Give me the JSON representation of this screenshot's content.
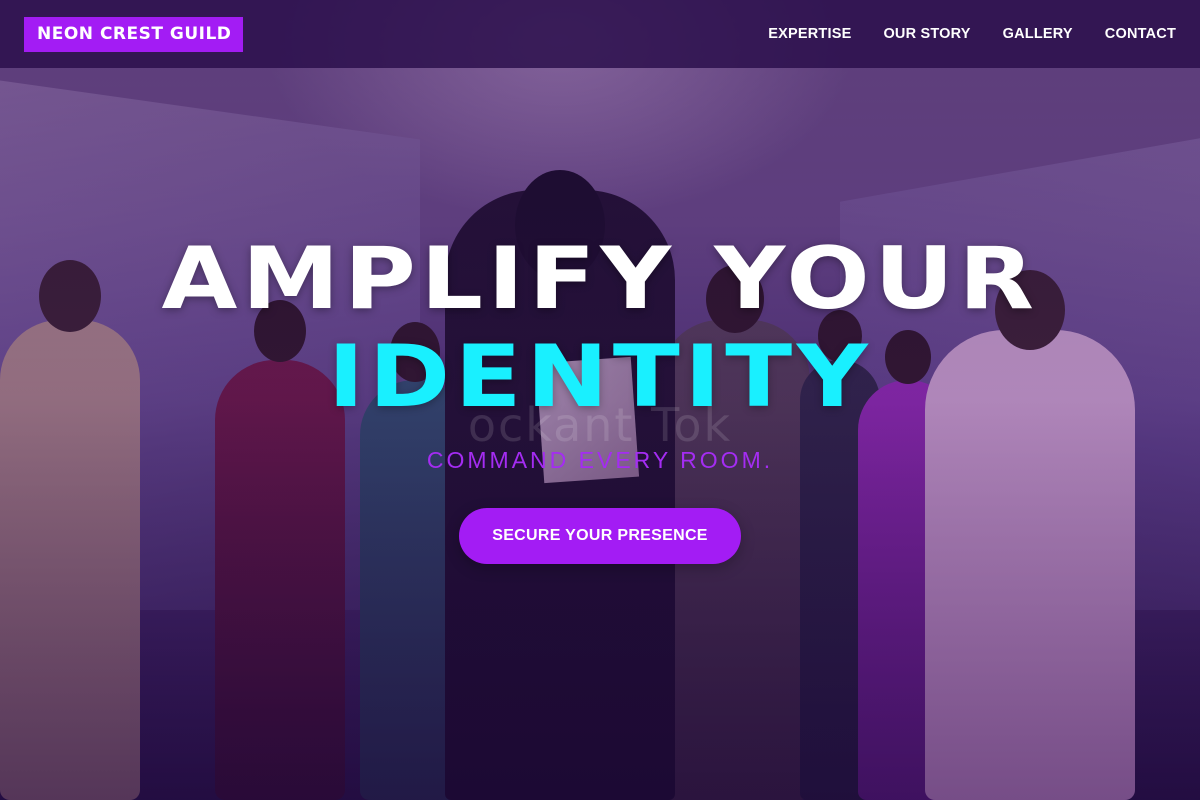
{
  "header": {
    "logo": "NEON CREST GUILD",
    "nav": [
      {
        "label": "EXPERTISE"
      },
      {
        "label": "OUR STORY"
      },
      {
        "label": "GALLERY"
      },
      {
        "label": "CONTACT"
      }
    ]
  },
  "hero": {
    "headline_line1": "AMPLIFY YOUR",
    "headline_line2": "IDENTITY",
    "background_text": "ockant Tok",
    "tagline": "COMMAND EVERY ROOM.",
    "cta_label": "SECURE YOUR PRESENCE"
  },
  "colors": {
    "accent_purple": "#a31cf4",
    "headline_cyan": "#19f0ff",
    "header_bg": "#2a0e4a"
  }
}
